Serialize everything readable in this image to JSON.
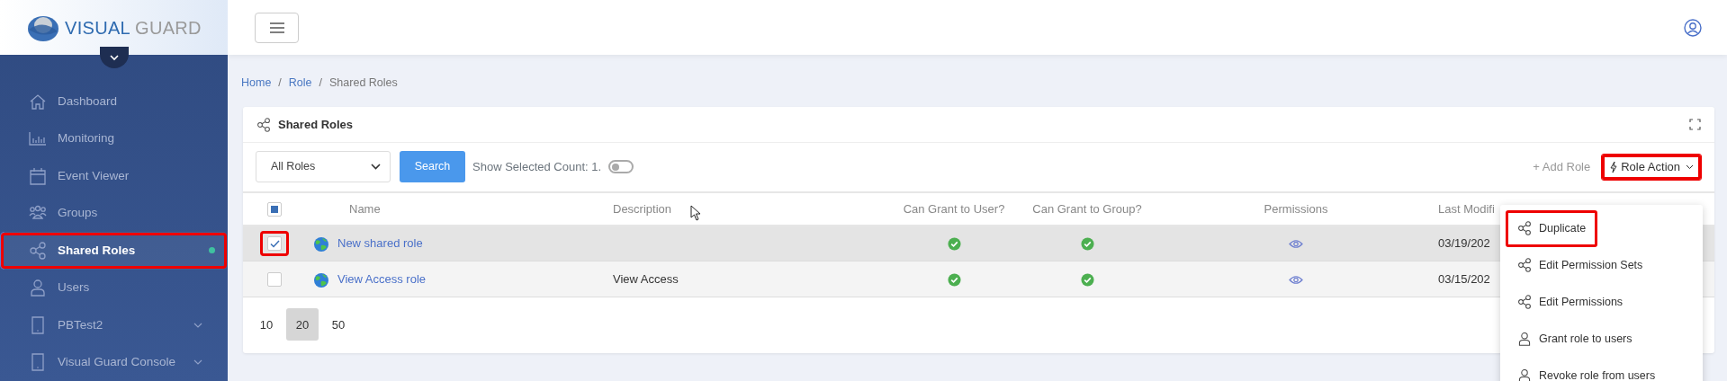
{
  "brand": {
    "primary": "VISUAL",
    "secondary": "GUARD"
  },
  "sidebar": {
    "items": [
      {
        "label": "Dashboard",
        "selected": false,
        "expandable": false,
        "highlighted": false
      },
      {
        "label": "Monitoring",
        "selected": false,
        "expandable": false,
        "highlighted": false
      },
      {
        "label": "Event Viewer",
        "selected": false,
        "expandable": false,
        "highlighted": false
      },
      {
        "label": "Groups",
        "selected": false,
        "expandable": false,
        "highlighted": false
      },
      {
        "label": "Shared Roles",
        "selected": true,
        "expandable": false,
        "highlighted": true
      },
      {
        "label": "Users",
        "selected": false,
        "expandable": false,
        "highlighted": false
      },
      {
        "label": "PBTest2",
        "selected": false,
        "expandable": true,
        "highlighted": false
      },
      {
        "label": "Visual Guard Console",
        "selected": false,
        "expandable": true,
        "highlighted": false
      }
    ]
  },
  "breadcrumb": {
    "separator": "/",
    "items": [
      "Home",
      "Role",
      "Shared Roles"
    ]
  },
  "card": {
    "title": "Shared Roles",
    "filter": {
      "value": "All Roles"
    },
    "search_button": "Search",
    "toggle": {
      "label": "Show Selected Count: 1.",
      "on": false
    },
    "add_button": "+ Add Role",
    "action_button": {
      "label": "Role Action",
      "highlighted": true
    },
    "table": {
      "header_checkbox": {
        "indeterminate": true
      },
      "columns": [
        "Name",
        "Description",
        "Can Grant to User?",
        "Can Grant to Group?",
        "Permissions",
        "Last Modifi"
      ],
      "rows": [
        {
          "name": "New shared role",
          "description": "",
          "can_grant_user": true,
          "can_grant_group": true,
          "last_modified": "03/19/202",
          "selected": true,
          "checked": true,
          "highlighted": true
        },
        {
          "name": "View Access role",
          "description": "View Access",
          "can_grant_user": true,
          "can_grant_group": true,
          "last_modified": "03/15/202",
          "selected": false,
          "checked": false,
          "highlighted": false
        }
      ]
    },
    "page_sizes": [
      {
        "label": "10",
        "selected": false
      },
      {
        "label": "20",
        "selected": true
      },
      {
        "label": "50",
        "selected": false
      }
    ],
    "menu": {
      "items": [
        {
          "label": "Duplicate",
          "highlighted": true
        },
        {
          "label": "Edit Permission Sets",
          "highlighted": false
        },
        {
          "label": "Edit Permissions",
          "highlighted": false
        },
        {
          "label": "Grant role to users",
          "highlighted": false
        },
        {
          "label": "Revoke role from users",
          "highlighted": false
        }
      ]
    }
  }
}
